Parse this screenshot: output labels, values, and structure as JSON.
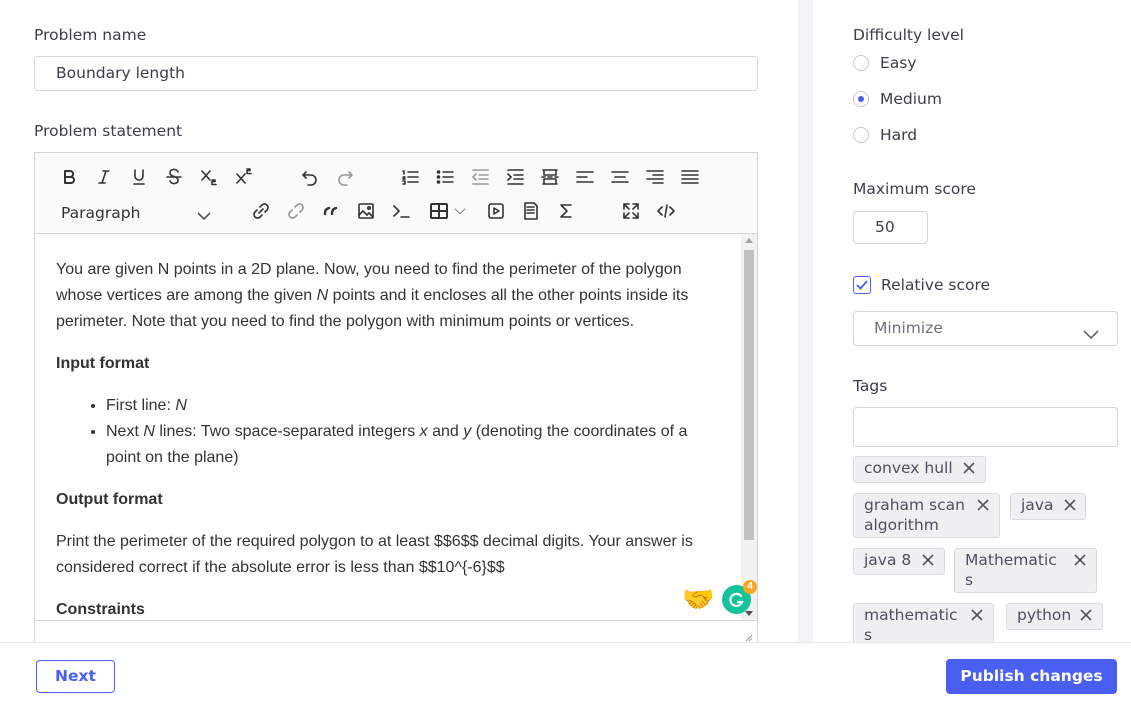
{
  "problem": {
    "name_label": "Problem name",
    "name_value": "Boundary length",
    "statement_label": "Problem statement"
  },
  "editor": {
    "block_format": "Paragraph",
    "intro_1": "You are given N points in a 2D plane. Now, you need to find the perimeter of the polygon whose vertices are among the given ",
    "intro_n": "N",
    "intro_2": " points and it encloses all the other points inside its perimeter. Note that you need to find the polygon with minimum points or vertices.",
    "input_heading": "Input format",
    "first_line_prefix": "First line: ",
    "first_line_var": "N",
    "next_prefix": "Next ",
    "next_var": "N",
    "next_mid": " lines: Two space-separated integers ",
    "var_x": "x",
    "and_word": " and ",
    "var_y": "y",
    "next_suffix": " (denoting the coordinates of a point on the plane)",
    "output_heading": "Output format",
    "output_text": "Print the perimeter of the required polygon to at least $$6$$ decimal digits. Your answer is considered correct if the absolute error is less than $$10^{-6}$$",
    "constraints_heading": "Constraints",
    "grammarly_count": "4"
  },
  "difficulty": {
    "label": "Difficulty level",
    "options": [
      "Easy",
      "Medium",
      "Hard"
    ],
    "selected": "Medium"
  },
  "score": {
    "label": "Maximum score",
    "value": "50",
    "relative_label": "Relative score",
    "relative_checked": true,
    "mode": "Minimize"
  },
  "tags": {
    "label": "Tags",
    "items": [
      {
        "line1": "convex hull",
        "line2": ""
      },
      {
        "line1": "graham scan",
        "line2": "algorithm"
      },
      {
        "line1": "java",
        "line2": ""
      },
      {
        "line1": "java 8",
        "line2": ""
      },
      {
        "line1": "Mathematic",
        "line2": "s"
      },
      {
        "line1": "mathematic",
        "line2": "s"
      },
      {
        "line1": "python",
        "line2": ""
      }
    ]
  },
  "footer": {
    "next_label": "Next",
    "publish_label": "Publish changes"
  },
  "colors": {
    "accent": "#4a5ff1",
    "grammarly": "#15c39a"
  },
  "icons": [
    "bold-icon",
    "italic-icon",
    "underline-icon",
    "strikethrough-icon",
    "subscript-icon",
    "superscript-icon",
    "undo-icon",
    "redo-icon",
    "numbered-list-icon",
    "bullet-list-icon",
    "outdent-icon",
    "indent-icon",
    "page-break-icon",
    "align-left-icon",
    "align-center-icon",
    "align-right-icon",
    "justify-icon",
    "link-icon",
    "unlink-icon",
    "blockquote-icon",
    "image-icon",
    "code-block-icon",
    "table-icon",
    "media-icon",
    "pdf-icon",
    "math-icon",
    "fullscreen-icon",
    "source-code-icon",
    "close-icon",
    "chevron-down-icon",
    "check-icon",
    "handshake-icon",
    "grammarly-icon"
  ]
}
